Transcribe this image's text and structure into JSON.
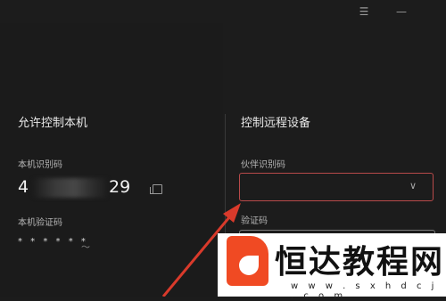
{
  "window": {
    "menu_icon": "☰",
    "minimize_icon": "—"
  },
  "left": {
    "title": "允许控制本机",
    "id_label": "本机识别码",
    "id_prefix": "4",
    "id_suffix": "29",
    "code_label": "本机验证码",
    "code_value": "* * * * * *",
    "refresh_icon": "〜"
  },
  "right": {
    "title": "控制远程设备",
    "partner_label": "伙伴识别码",
    "partner_placeholder": "",
    "code_label": "验证码",
    "dropdown_icon": "∨"
  },
  "watermark": {
    "name": "恒达教程网",
    "url": "w w w . s x h d c j . c o m"
  },
  "colors": {
    "bg": "#1c1c1c",
    "focus_border": "#b84a4a",
    "arrow": "#d93a2b",
    "brand": "#f04a23"
  }
}
